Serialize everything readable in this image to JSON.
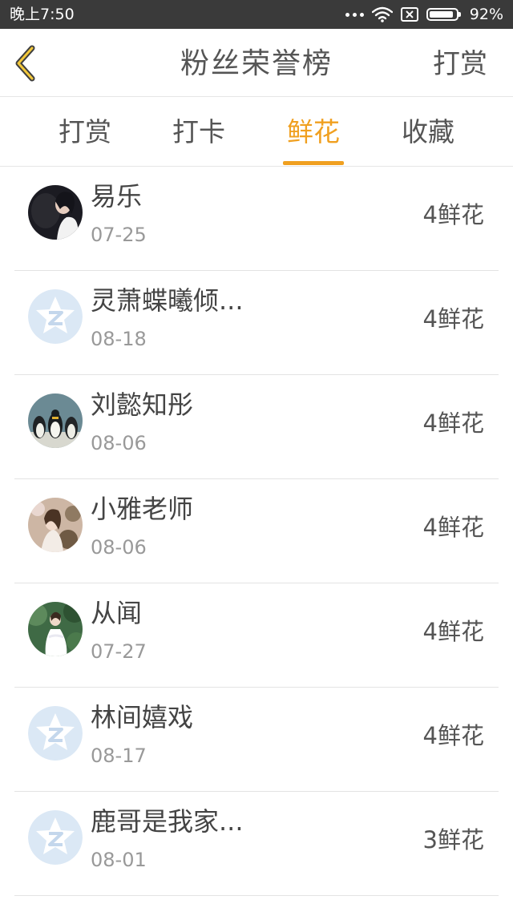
{
  "status_bar": {
    "time": "晚上7:50",
    "battery_percent": "92%",
    "battery_level": 0.92,
    "icons": [
      "more-dots-icon",
      "wifi-icon",
      "no-sim-icon",
      "battery-icon"
    ]
  },
  "header": {
    "back_icon": "chevron-left-icon",
    "title": "粉丝荣誉榜",
    "action_label": "打赏"
  },
  "tabs": [
    {
      "label": "打赏",
      "active": false
    },
    {
      "label": "打卡",
      "active": false
    },
    {
      "label": "鲜花",
      "active": true
    },
    {
      "label": "收藏",
      "active": false
    }
  ],
  "colors": {
    "accent": "#f0a020",
    "default_avatar": "#dbe8f5"
  },
  "list": [
    {
      "name": "易乐",
      "date": "07-25",
      "count": "4鲜花",
      "avatar": "photo-girl-dark"
    },
    {
      "name": "灵萧蝶曦倾...",
      "date": "08-18",
      "count": "4鲜花",
      "avatar": "default-avatar-icon"
    },
    {
      "name": "刘懿知彤",
      "date": "08-06",
      "count": "4鲜花",
      "avatar": "photo-penguins"
    },
    {
      "name": "小雅老师",
      "date": "08-06",
      "count": "4鲜花",
      "avatar": "photo-woman-flowers"
    },
    {
      "name": "从闻",
      "date": "07-27",
      "count": "4鲜花",
      "avatar": "photo-girl-white-dress"
    },
    {
      "name": "林间嬉戏",
      "date": "08-17",
      "count": "4鲜花",
      "avatar": "default-avatar-icon"
    },
    {
      "name": "鹿哥是我家...",
      "date": "08-01",
      "count": "3鲜花",
      "avatar": "default-avatar-icon"
    }
  ]
}
